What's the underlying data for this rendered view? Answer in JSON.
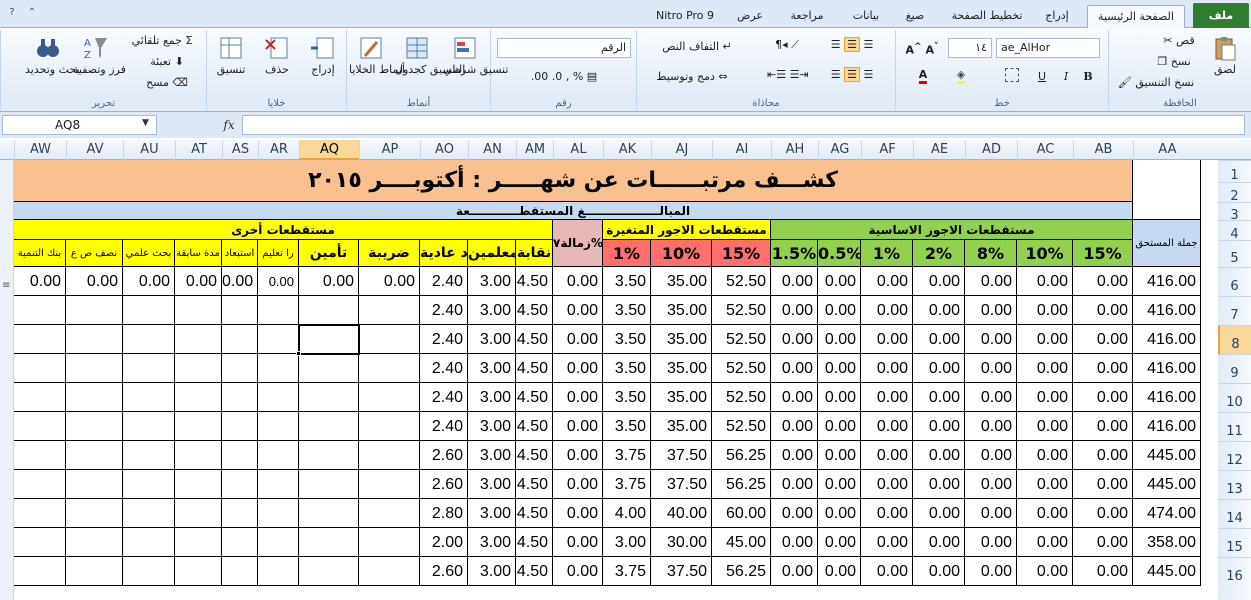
{
  "tabs": {
    "file": "ملف",
    "home": "الصفحة الرئيسية",
    "insert": "إدراج",
    "page_layout": "تخطيط الصفحة",
    "formulas": "صيغ",
    "data": "بيانات",
    "review": "مراجعة",
    "view": "عرض",
    "nitro": "Nitro Pro 9"
  },
  "ribbon": {
    "clipboard": {
      "label": "الحافظة",
      "paste": "لصق",
      "cut": "قص",
      "copy": "نسخ",
      "format_painter": "نسخ التنسيق"
    },
    "font": {
      "label": "خط",
      "name": "ae_AlHor",
      "size": "١٤",
      "bold": "B",
      "italic": "I",
      "underline": "U"
    },
    "alignment": {
      "label": "محاذاة",
      "wrap": "التفاف النص",
      "merge": "دمج وتوسيط"
    },
    "number": {
      "label": "رقم",
      "format": "الرقم"
    },
    "styles": {
      "label": "أنماط",
      "conditional": "تنسيق شرطي",
      "as_table": "التنسيق كجدول",
      "cell_styles": "أنماط الخلايا"
    },
    "cells": {
      "label": "خلايا",
      "insert": "إدراج",
      "delete": "حذف",
      "format": "تنسيق"
    },
    "editing": {
      "label": "تحرير",
      "autosum": "جمع تلقائي",
      "fill": "تعبئة",
      "clear": "مسح",
      "sort": "فرز وتصفية",
      "find": "بحث وتحديد"
    }
  },
  "formula_bar": {
    "name_box": "AQ8",
    "fx": "fx",
    "value": ""
  },
  "columns": [
    "AW",
    "AV",
    "AU",
    "AT",
    "AS",
    "AR",
    "AQ",
    "AP",
    "AO",
    "AN",
    "AM",
    "AL",
    "AK",
    "AJ",
    "AI",
    "AH",
    "AG",
    "AF",
    "AE",
    "AD",
    "AC",
    "AB",
    "AA"
  ],
  "selected_column": "AQ",
  "rows": [
    "1",
    "2",
    "3",
    "4",
    "5",
    "6",
    "7",
    "8",
    "9",
    "10",
    "11",
    "12",
    "13",
    "14",
    "15",
    "16"
  ],
  "selected_row": "8",
  "sheet": {
    "title": "كشـــف مرتبــــــات عن شهـــــر : أكتوبــــر ٢٠١٥",
    "deductions_header": "المبالــــــــــــــــــغ المستقطــــــــــــعة",
    "group_other": "مستقطعات أخرى",
    "group_variable": "مستقطعات الاجور المتغيرة",
    "group_basic": "مستقطعات الاجور الاساسية",
    "col_total_due": "جملة المستحق",
    "col_zamala": "زمالة٧%",
    "sub_other": [
      "بنك التنمية",
      "نصف ص ع",
      "بحث علمي",
      "مدة سابقة",
      "استبعاد",
      "را تعليم",
      "تأمين",
      "ضريبة",
      "د عادية",
      "ن معلمين",
      "نقابة"
    ],
    "sub_variable": [
      "1%",
      "10%",
      "15%"
    ],
    "sub_basic": [
      "1.5%",
      "0.5%",
      "1%",
      "2%",
      "8%",
      "10%",
      "15%"
    ],
    "data_rows": [
      {
        "other": [
          "0.00",
          "0.00",
          "0.00",
          "0.00",
          "0.00",
          "0.00",
          "0.00",
          "0.00",
          "2.40",
          "3.00",
          "4.50"
        ],
        "zamala": "0.00",
        "var": [
          "3.50",
          "35.00",
          "52.50"
        ],
        "basic": [
          "0.00",
          "0.00",
          "0.00",
          "0.00",
          "0.00",
          "0.00",
          "0.00"
        ],
        "total": "416.00"
      },
      {
        "other": [
          "",
          "",
          "",
          "",
          "",
          "",
          "",
          "",
          "2.40",
          "3.00",
          "4.50"
        ],
        "zamala": "0.00",
        "var": [
          "3.50",
          "35.00",
          "52.50"
        ],
        "basic": [
          "0.00",
          "0.00",
          "0.00",
          "0.00",
          "0.00",
          "0.00",
          "0.00"
        ],
        "total": "416.00"
      },
      {
        "other": [
          "",
          "",
          "",
          "",
          "",
          "",
          "",
          "",
          "2.40",
          "3.00",
          "4.50"
        ],
        "zamala": "0.00",
        "var": [
          "3.50",
          "35.00",
          "52.50"
        ],
        "basic": [
          "0.00",
          "0.00",
          "0.00",
          "0.00",
          "0.00",
          "0.00",
          "0.00"
        ],
        "total": "416.00"
      },
      {
        "other": [
          "",
          "",
          "",
          "",
          "",
          "",
          "",
          "",
          "2.40",
          "3.00",
          "4.50"
        ],
        "zamala": "0.00",
        "var": [
          "3.50",
          "35.00",
          "52.50"
        ],
        "basic": [
          "0.00",
          "0.00",
          "0.00",
          "0.00",
          "0.00",
          "0.00",
          "0.00"
        ],
        "total": "416.00"
      },
      {
        "other": [
          "",
          "",
          "",
          "",
          "",
          "",
          "",
          "",
          "2.40",
          "3.00",
          "4.50"
        ],
        "zamala": "0.00",
        "var": [
          "3.50",
          "35.00",
          "52.50"
        ],
        "basic": [
          "0.00",
          "0.00",
          "0.00",
          "0.00",
          "0.00",
          "0.00",
          "0.00"
        ],
        "total": "416.00"
      },
      {
        "other": [
          "",
          "",
          "",
          "",
          "",
          "",
          "",
          "",
          "2.40",
          "3.00",
          "4.50"
        ],
        "zamala": "0.00",
        "var": [
          "3.50",
          "35.00",
          "52.50"
        ],
        "basic": [
          "0.00",
          "0.00",
          "0.00",
          "0.00",
          "0.00",
          "0.00",
          "0.00"
        ],
        "total": "416.00"
      },
      {
        "other": [
          "",
          "",
          "",
          "",
          "",
          "",
          "",
          "",
          "2.60",
          "3.00",
          "4.50"
        ],
        "zamala": "0.00",
        "var": [
          "3.75",
          "37.50",
          "56.25"
        ],
        "basic": [
          "0.00",
          "0.00",
          "0.00",
          "0.00",
          "0.00",
          "0.00",
          "0.00"
        ],
        "total": "445.00"
      },
      {
        "other": [
          "",
          "",
          "",
          "",
          "",
          "",
          "",
          "",
          "2.60",
          "3.00",
          "4.50"
        ],
        "zamala": "0.00",
        "var": [
          "3.75",
          "37.50",
          "56.25"
        ],
        "basic": [
          "0.00",
          "0.00",
          "0.00",
          "0.00",
          "0.00",
          "0.00",
          "0.00"
        ],
        "total": "445.00"
      },
      {
        "other": [
          "",
          "",
          "",
          "",
          "",
          "",
          "",
          "",
          "2.80",
          "3.00",
          "4.50"
        ],
        "zamala": "0.00",
        "var": [
          "4.00",
          "40.00",
          "60.00"
        ],
        "basic": [
          "0.00",
          "0.00",
          "0.00",
          "0.00",
          "0.00",
          "0.00",
          "0.00"
        ],
        "total": "474.00"
      },
      {
        "other": [
          "",
          "",
          "",
          "",
          "",
          "",
          "",
          "",
          "2.00",
          "3.00",
          "4.50"
        ],
        "zamala": "0.00",
        "var": [
          "3.00",
          "30.00",
          "45.00"
        ],
        "basic": [
          "0.00",
          "0.00",
          "0.00",
          "0.00",
          "0.00",
          "0.00",
          "0.00"
        ],
        "total": "358.00"
      },
      {
        "other": [
          "",
          "",
          "",
          "",
          "",
          "",
          "",
          "",
          "2.60",
          "3.00",
          "4.50"
        ],
        "zamala": "0.00",
        "var": [
          "3.75",
          "37.50",
          "56.25"
        ],
        "basic": [
          "0.00",
          "0.00",
          "0.00",
          "0.00",
          "0.00",
          "0.00",
          "0.00"
        ],
        "total": "445.00"
      }
    ]
  },
  "colors": {
    "title_bg": "#fac090",
    "header_bg": "#c5d9f1",
    "other_bg": "#ffff00",
    "variable_bg": "#ff6f6f",
    "basic_bg": "#92d050",
    "zamala_bg": "#e6b9b8",
    "selection": "#f9d99a"
  }
}
